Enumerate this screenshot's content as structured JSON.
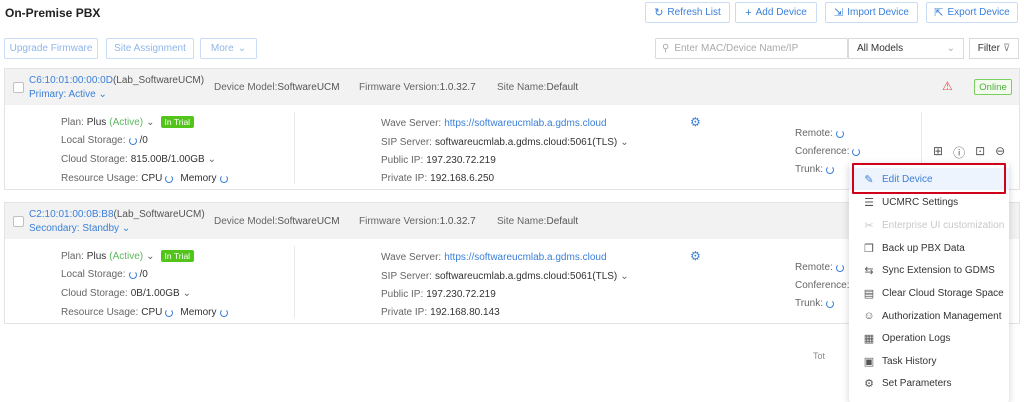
{
  "header": {
    "title": "On-Premise PBX",
    "refresh_label": "Refresh List",
    "add_label": "Add Device",
    "import_label": "Import Device",
    "export_label": "Export Device"
  },
  "toolbar": {
    "upgrade_label": "Upgrade Firmware",
    "site_label": "Site Assignment",
    "more_label": "More",
    "search_placeholder": "Enter MAC/Device Name/IP",
    "model_select": "All Models",
    "filter_label": "Filter"
  },
  "devices": [
    {
      "mac": "C6:10:01:00:00:0D",
      "name": "(Lab_SoftwareUCM)",
      "role": "Primary: Active",
      "model_label": "Device Model:",
      "model": "SoftwareUCM",
      "firmware_label": "Firmware Version:",
      "firmware": "1.0.32.7",
      "site_label": "Site Name:",
      "site": "Default",
      "status": "Online",
      "plan_label": "Plan:",
      "plan": "Plus",
      "plan_state": "(Active)",
      "trial": "In Trial",
      "local_storage_label": "Local Storage:",
      "local_storage": "/0",
      "cloud_storage_label": "Cloud Storage:",
      "cloud_storage": "815.00B/1.00GB",
      "resource_label": "Resource Usage:",
      "cpu_label": "CPU",
      "memory_label": "Memory",
      "wave_label": "Wave Server:",
      "wave": "https://softwareucmlab.a.gdms.cloud",
      "sip_label": "SIP Server:",
      "sip": "softwareucmlab.a.gdms.cloud:5061(TLS)",
      "public_label": "Public IP:",
      "public_ip": "197.230.72.219",
      "private_label": "Private IP:",
      "private_ip": "192.168.6.250",
      "remote_label": "Remote:",
      "conference_label": "Conference:",
      "trunk_label": "Trunk:"
    },
    {
      "mac": "C2:10:01:00:0B:B8",
      "name": "(Lab_SoftwareUCM)",
      "role": "Secondary: Standby",
      "model_label": "Device Model:",
      "model": "SoftwareUCM",
      "firmware_label": "Firmware Version:",
      "firmware": "1.0.32.7",
      "site_label": "Site Name:",
      "site": "Default",
      "plan_label": "Plan:",
      "plan": "Plus",
      "plan_state": "(Active)",
      "trial": "In Trial",
      "local_storage_label": "Local Storage:",
      "local_storage": "/0",
      "cloud_storage_label": "Cloud Storage:",
      "cloud_storage": "0B/1.00GB",
      "resource_label": "Resource Usage:",
      "cpu_label": "CPU",
      "memory_label": "Memory",
      "wave_label": "Wave Server:",
      "wave": "https://softwareucmlab.a.gdms.cloud",
      "sip_label": "SIP Server:",
      "sip": "softwareucmlab.a.gdms.cloud:5061(TLS)",
      "public_label": "Public IP:",
      "public_ip": "197.230.72.219",
      "private_label": "Private IP:",
      "private_ip": "192.168.80.143",
      "remote_label": "Remote:",
      "conference_label": "Conference:",
      "trunk_label": "Trunk:"
    }
  ],
  "menu": {
    "items": [
      {
        "label": "Edit Device",
        "icon": "edit-icon"
      },
      {
        "label": "UCMRC Settings",
        "icon": "sliders-icon"
      },
      {
        "label": "Enterprise UI customization",
        "icon": "brush-icon"
      },
      {
        "label": "Back up PBX Data",
        "icon": "copy-icon"
      },
      {
        "label": "Sync Extension to GDMS",
        "icon": "sync-icon"
      },
      {
        "label": "Clear Cloud Storage Space",
        "icon": "storage-icon"
      },
      {
        "label": "Authorization Management",
        "icon": "user-key-icon"
      },
      {
        "label": "Operation Logs",
        "icon": "log-icon"
      },
      {
        "label": "Task History",
        "icon": "history-icon"
      },
      {
        "label": "Set Parameters",
        "icon": "gear-icon"
      }
    ]
  },
  "footer": {
    "total_label": "Tot"
  },
  "colors": {
    "accent": "#3a7fd9",
    "online": "#4caf3a",
    "trial": "#52c41a",
    "highlight_border": "#d0021b"
  }
}
